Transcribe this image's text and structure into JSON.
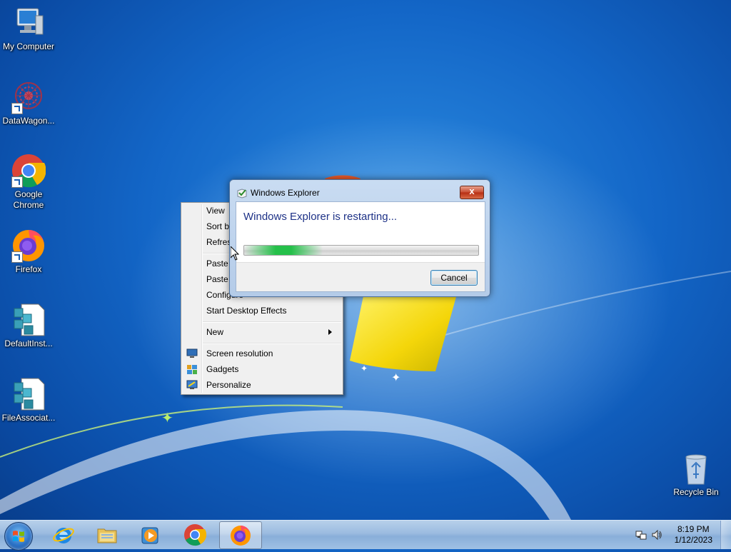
{
  "desktop": {
    "icons": [
      {
        "label": "My Computer",
        "icon": "computer-icon"
      },
      {
        "label": "DataWagon...",
        "icon": "datawagon-icon"
      },
      {
        "label": "Google Chrome",
        "icon": "chrome-icon"
      },
      {
        "label": "Firefox",
        "icon": "firefox-icon"
      },
      {
        "label": "DefaultInst...",
        "icon": "registry-file-icon"
      },
      {
        "label": "FileAssociat...",
        "icon": "registry-file-icon"
      },
      {
        "label": "Recycle Bin",
        "icon": "recycle-bin-icon"
      }
    ]
  },
  "context_menu": {
    "items": [
      {
        "label": "View"
      },
      {
        "label": "Sort by"
      },
      {
        "label": "Refresh"
      },
      {
        "label": "Paste"
      },
      {
        "label": "Paste shortcut"
      },
      {
        "label": "Configure"
      },
      {
        "label": "Start Desktop Effects"
      },
      {
        "label": "New",
        "submenu": true
      },
      {
        "label": "Screen resolution",
        "icon": "screen-resolution-icon"
      },
      {
        "label": "Gadgets",
        "icon": "gadgets-icon"
      },
      {
        "label": "Personalize",
        "icon": "personalize-icon"
      }
    ]
  },
  "dialog": {
    "title": "Windows Explorer",
    "message": "Windows Explorer is restarting...",
    "cancel_label": "Cancel",
    "close_label": "x",
    "progress": "indeterminate"
  },
  "taskbar": {
    "items": [
      {
        "name": "internet-explorer",
        "icon": "ie-icon"
      },
      {
        "name": "file-explorer",
        "icon": "folder-icon"
      },
      {
        "name": "media-player",
        "icon": "media-player-icon"
      },
      {
        "name": "chrome",
        "icon": "chrome-icon"
      },
      {
        "name": "firefox",
        "icon": "firefox-icon",
        "active": true
      }
    ],
    "clock": {
      "time": "8:19 PM",
      "date": "1/12/2023"
    }
  },
  "colors": {
    "desktop_bg": "#1366c7",
    "dialog_message": "#1e3287",
    "progress_green": "#25c04a"
  }
}
